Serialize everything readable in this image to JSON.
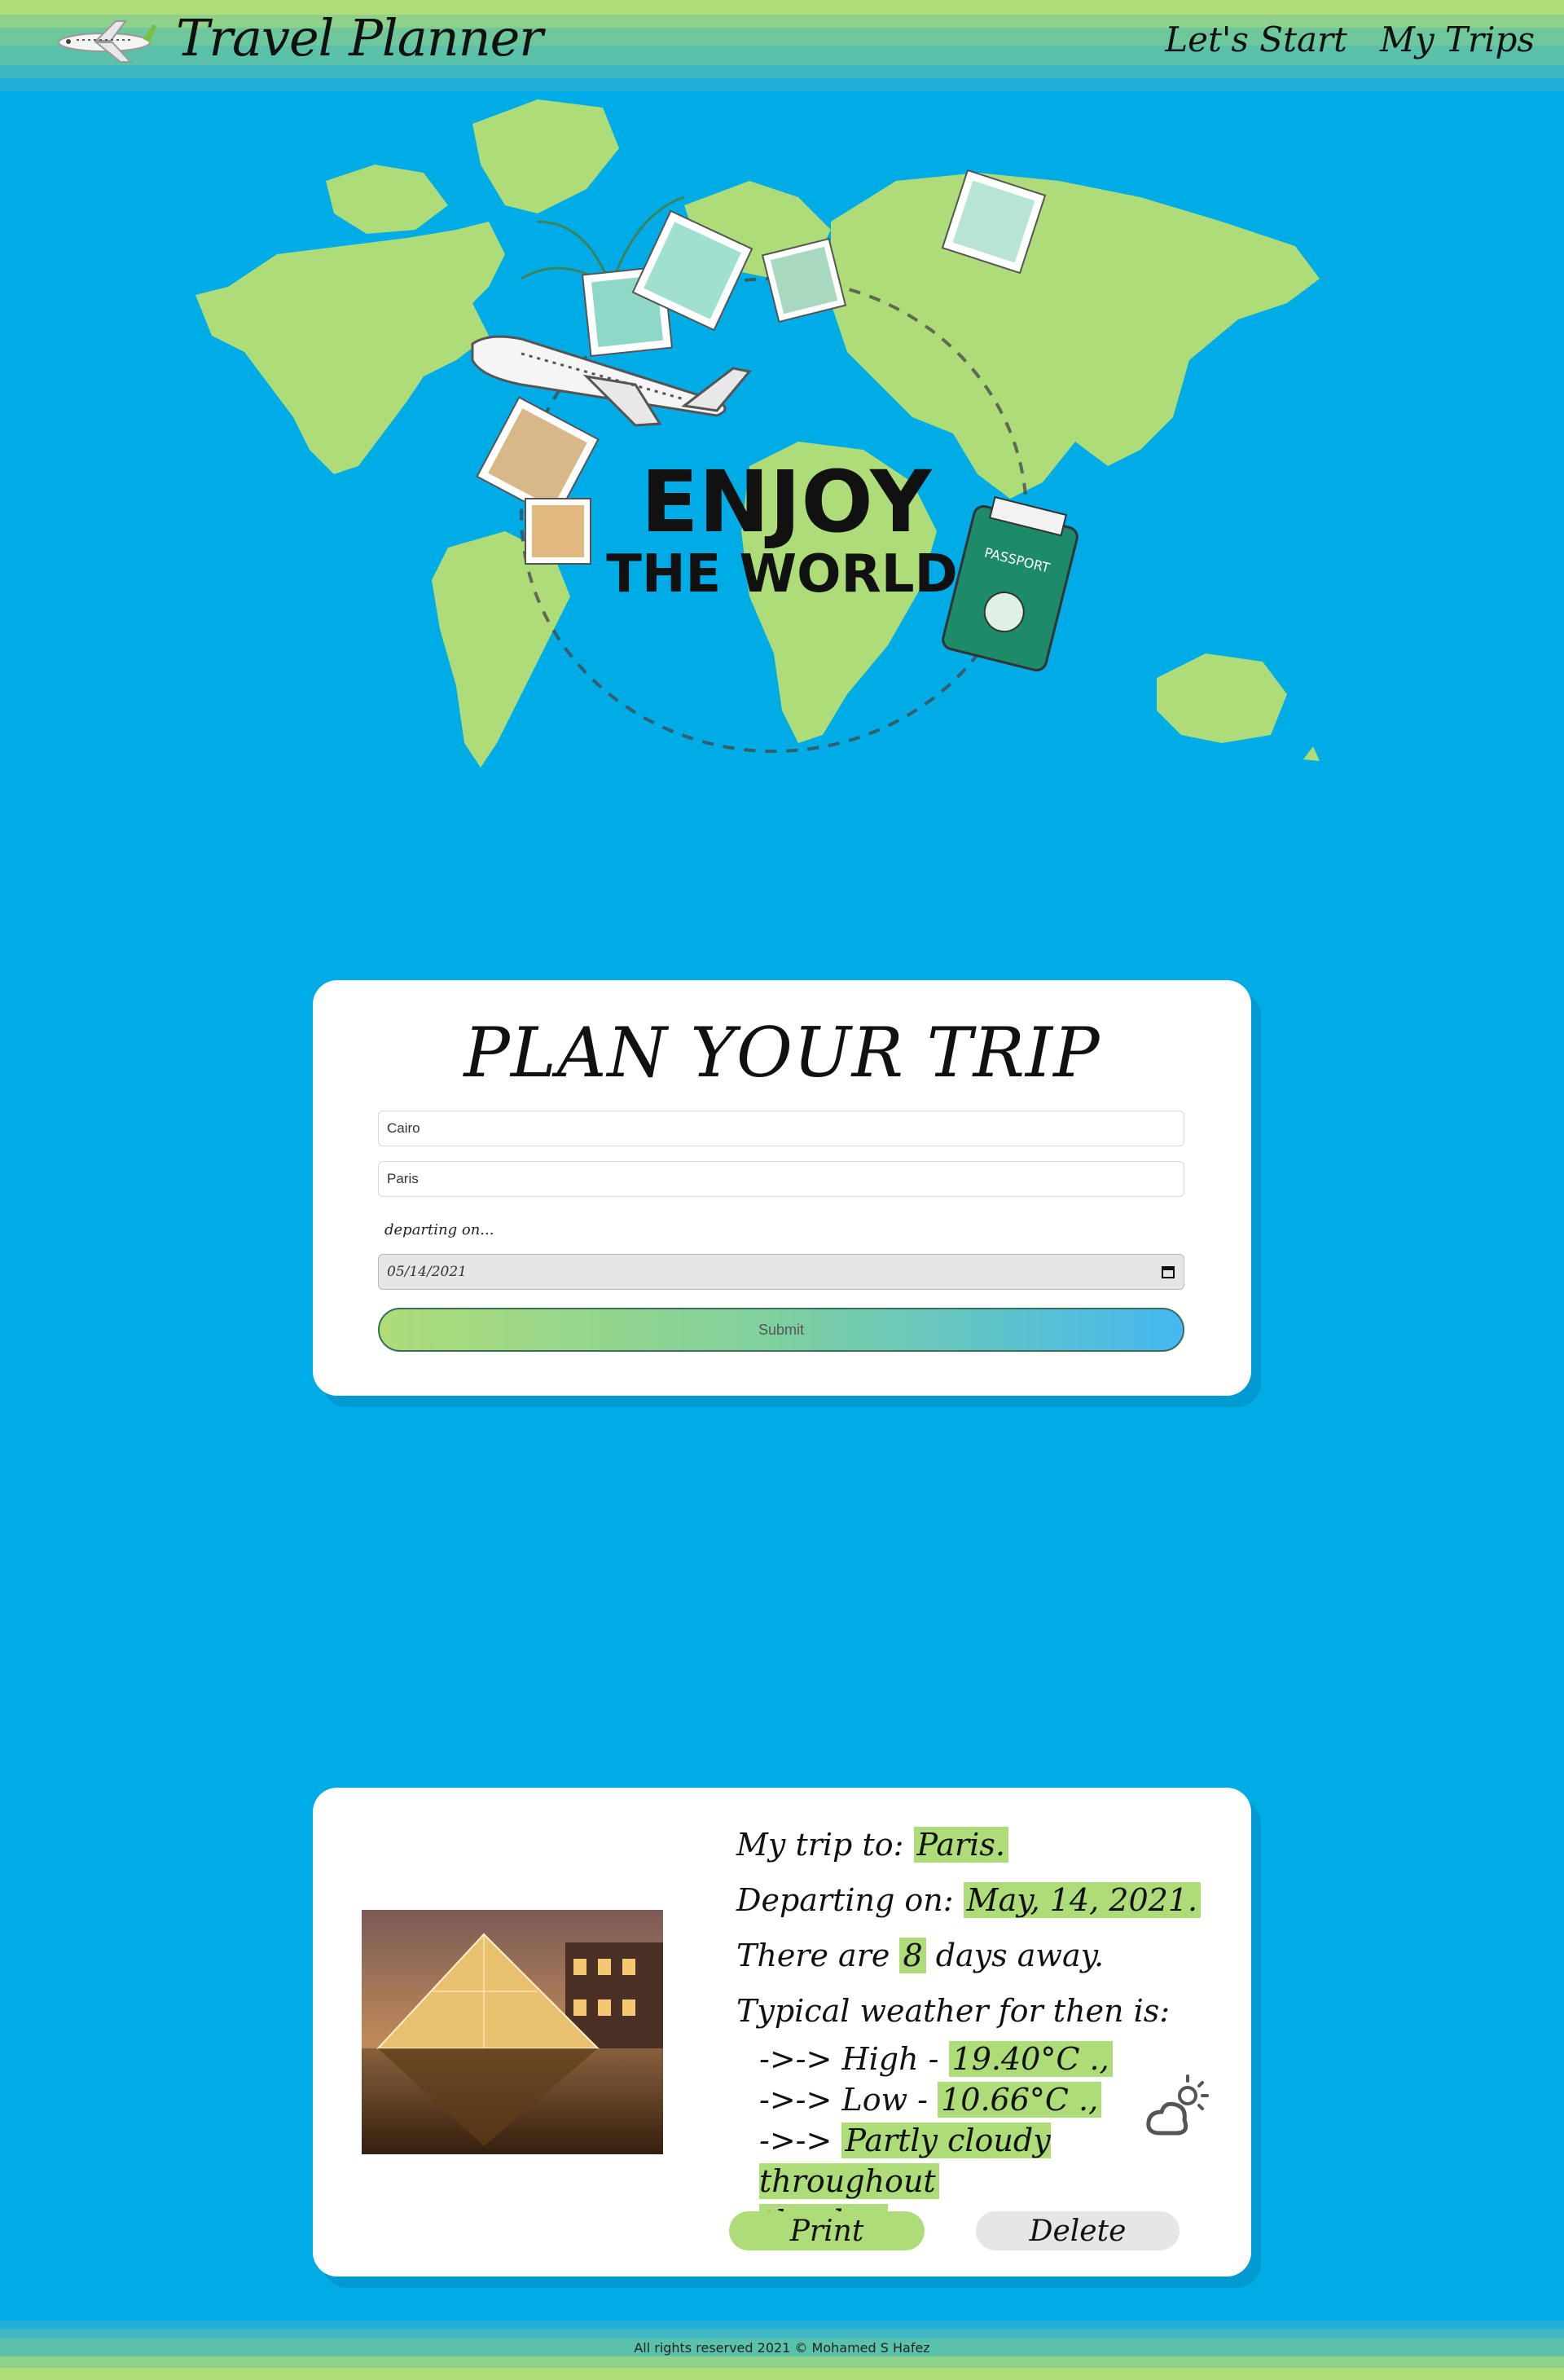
{
  "header": {
    "brand": "Travel Planner",
    "logo_icon": "airplane-icon",
    "nav": [
      {
        "label": "Let's Start"
      },
      {
        "label": "My Trips"
      }
    ]
  },
  "hero": {
    "headline_top": "ENJOY",
    "headline_bottom": "THE WORLD",
    "passport_label": "PASSPORT",
    "colors": {
      "land": "#aedc78",
      "ocean": "#00ace6"
    }
  },
  "plan": {
    "title": "PLAN YOUR TRIP",
    "from_value": "Cairo",
    "to_value": "Paris",
    "departing_label": "departing on...",
    "date_value": "05/14/2021",
    "submit_label": "Submit"
  },
  "trip": {
    "prefix_to": "My trip to:",
    "destination": "Paris.",
    "prefix_departing": "Departing on:",
    "date": "May, 14, 2021.",
    "days_prefix": "There are",
    "days": "8",
    "days_suffix": "days away.",
    "weather_title": "Typical weather for then is:",
    "arrow": "->->",
    "high_label": "High -",
    "high": "19.40°C .,",
    "low_label": "Low -",
    "low": "10.66°C .,",
    "desc_1": "Partly cloudy throughout",
    "desc_2": "the day.",
    "weather_icon": "partly-cloudy-icon",
    "print_label": "Print",
    "delete_label": "Delete"
  },
  "footer": {
    "text": "All rights reserved 2021 © Mohamed S Hafez"
  }
}
